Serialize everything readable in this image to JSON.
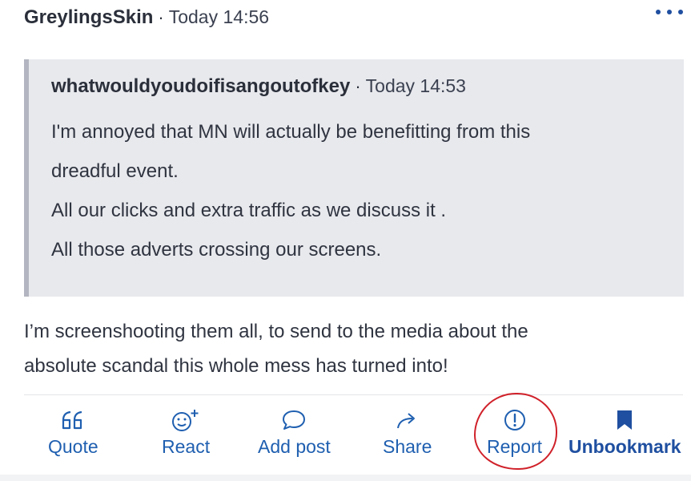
{
  "post": {
    "author": "GreylingsSkin",
    "separator": "·",
    "time": "Today 14:56",
    "more_icon": "ellipsis-icon"
  },
  "quote": {
    "author": "whatwouldyoudoifisangoutofkey",
    "separator": "·",
    "time": "Today 14:53",
    "lines": [
      "I'm annoyed that MN will actually be benefitting from this",
      "dreadful event.",
      "All our clicks and extra traffic as we discuss it .",
      "All those adverts crossing our screens."
    ]
  },
  "body": {
    "lines": [
      "I’m screenshooting them all, to send to the media about the",
      "absolute scandal this whole mess has turned into!"
    ]
  },
  "actions": {
    "quote": {
      "label": "Quote",
      "icon": "quote-icon"
    },
    "react": {
      "label": "React",
      "icon": "smiley-plus-icon"
    },
    "add_post": {
      "label": "Add post",
      "icon": "speech-bubble-icon"
    },
    "share": {
      "label": "Share",
      "icon": "share-arrow-icon"
    },
    "report": {
      "label": "Report",
      "icon": "exclamation-circle-icon"
    },
    "bookmark": {
      "label": "Unbookmark",
      "icon": "bookmark-icon"
    }
  },
  "colors": {
    "accent": "#1f5fb0",
    "annotation_circle": "#d0212a",
    "quote_background": "#e8e9ed"
  }
}
